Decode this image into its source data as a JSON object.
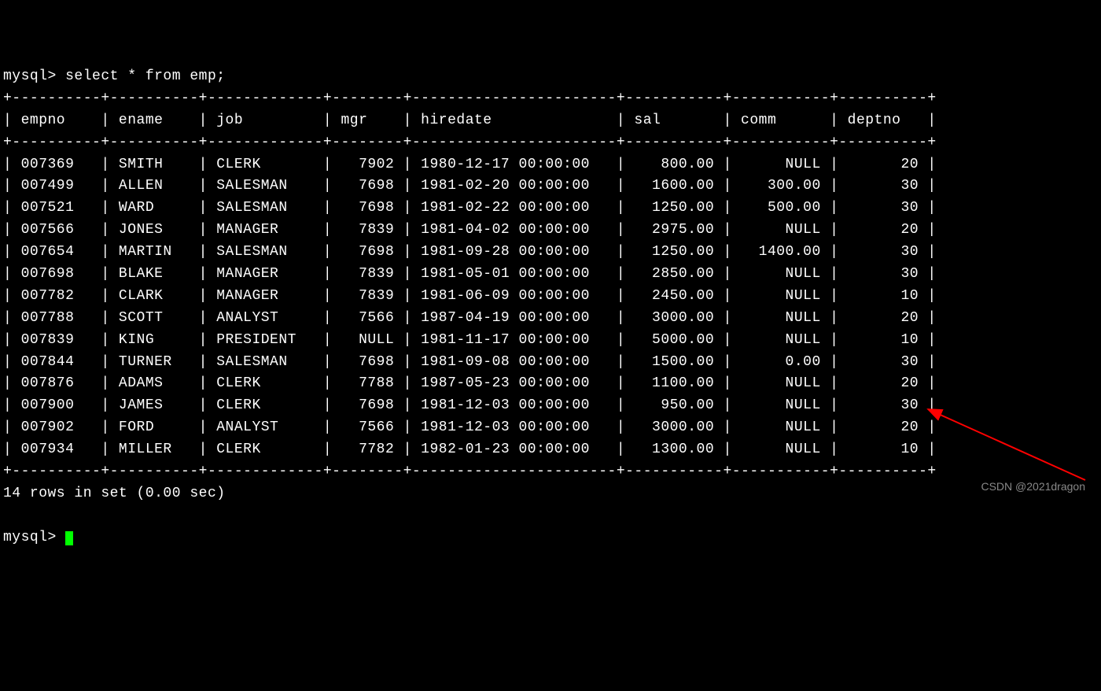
{
  "prompt1": "mysql> ",
  "query": "select * from emp;",
  "columns": [
    "empno",
    "ename",
    "job",
    "mgr",
    "hiredate",
    "sal",
    "comm",
    "deptno"
  ],
  "rows": [
    {
      "empno": "007369",
      "ename": "SMITH",
      "job": "CLERK",
      "mgr": "7902",
      "hiredate": "1980-12-17 00:00:00",
      "sal": "800.00",
      "comm": "NULL",
      "deptno": "20"
    },
    {
      "empno": "007499",
      "ename": "ALLEN",
      "job": "SALESMAN",
      "mgr": "7698",
      "hiredate": "1981-02-20 00:00:00",
      "sal": "1600.00",
      "comm": "300.00",
      "deptno": "30"
    },
    {
      "empno": "007521",
      "ename": "WARD",
      "job": "SALESMAN",
      "mgr": "7698",
      "hiredate": "1981-02-22 00:00:00",
      "sal": "1250.00",
      "comm": "500.00",
      "deptno": "30"
    },
    {
      "empno": "007566",
      "ename": "JONES",
      "job": "MANAGER",
      "mgr": "7839",
      "hiredate": "1981-04-02 00:00:00",
      "sal": "2975.00",
      "comm": "NULL",
      "deptno": "20"
    },
    {
      "empno": "007654",
      "ename": "MARTIN",
      "job": "SALESMAN",
      "mgr": "7698",
      "hiredate": "1981-09-28 00:00:00",
      "sal": "1250.00",
      "comm": "1400.00",
      "deptno": "30"
    },
    {
      "empno": "007698",
      "ename": "BLAKE",
      "job": "MANAGER",
      "mgr": "7839",
      "hiredate": "1981-05-01 00:00:00",
      "sal": "2850.00",
      "comm": "NULL",
      "deptno": "30"
    },
    {
      "empno": "007782",
      "ename": "CLARK",
      "job": "MANAGER",
      "mgr": "7839",
      "hiredate": "1981-06-09 00:00:00",
      "sal": "2450.00",
      "comm": "NULL",
      "deptno": "10"
    },
    {
      "empno": "007788",
      "ename": "SCOTT",
      "job": "ANALYST",
      "mgr": "7566",
      "hiredate": "1987-04-19 00:00:00",
      "sal": "3000.00",
      "comm": "NULL",
      "deptno": "20"
    },
    {
      "empno": "007839",
      "ename": "KING",
      "job": "PRESIDENT",
      "mgr": "NULL",
      "hiredate": "1981-11-17 00:00:00",
      "sal": "5000.00",
      "comm": "NULL",
      "deptno": "10"
    },
    {
      "empno": "007844",
      "ename": "TURNER",
      "job": "SALESMAN",
      "mgr": "7698",
      "hiredate": "1981-09-08 00:00:00",
      "sal": "1500.00",
      "comm": "0.00",
      "deptno": "30"
    },
    {
      "empno": "007876",
      "ename": "ADAMS",
      "job": "CLERK",
      "mgr": "7788",
      "hiredate": "1987-05-23 00:00:00",
      "sal": "1100.00",
      "comm": "NULL",
      "deptno": "20"
    },
    {
      "empno": "007900",
      "ename": "JAMES",
      "job": "CLERK",
      "mgr": "7698",
      "hiredate": "1981-12-03 00:00:00",
      "sal": "950.00",
      "comm": "NULL",
      "deptno": "30"
    },
    {
      "empno": "007902",
      "ename": "FORD",
      "job": "ANALYST",
      "mgr": "7566",
      "hiredate": "1981-12-03 00:00:00",
      "sal": "3000.00",
      "comm": "NULL",
      "deptno": "20"
    },
    {
      "empno": "007934",
      "ename": "MILLER",
      "job": "CLERK",
      "mgr": "7782",
      "hiredate": "1982-01-23 00:00:00",
      "sal": "1300.00",
      "comm": "NULL",
      "deptno": "10"
    }
  ],
  "status": "14 rows in set (0.00 sec)",
  "prompt2": "mysql> ",
  "watermark": "CSDN @2021dragon",
  "widths": {
    "empno": 8,
    "ename": 8,
    "job": 11,
    "mgr": 6,
    "hiredate": 21,
    "sal": 9,
    "comm": 9,
    "deptno": 8
  }
}
